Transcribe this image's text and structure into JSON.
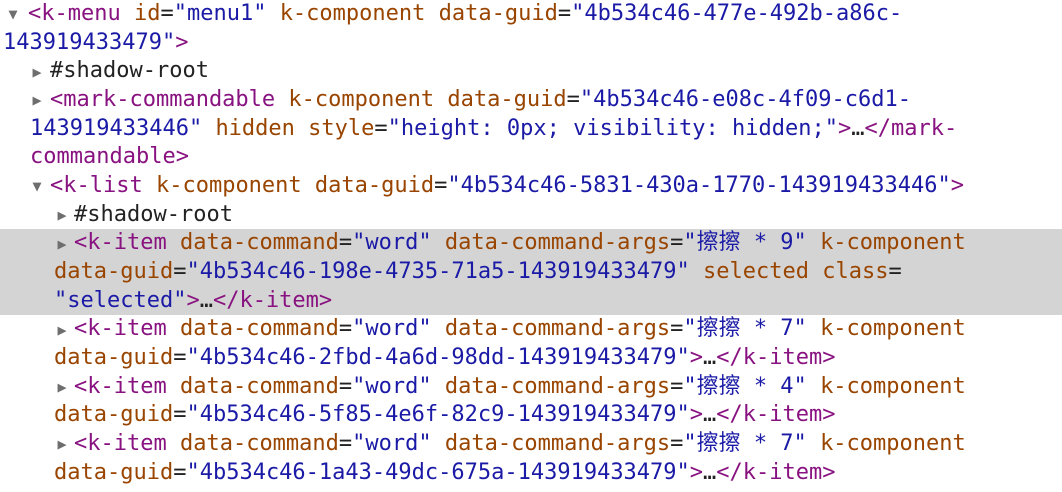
{
  "dom_tree": {
    "nodes": [
      {
        "state": "expanded",
        "lines": [
          [
            [
              "tag",
              "<k-menu"
            ],
            [
              "pl",
              " "
            ],
            [
              "an",
              "id"
            ],
            [
              "pl",
              "="
            ],
            [
              "av",
              "\"menu1\""
            ],
            [
              "pl",
              " "
            ],
            [
              "an",
              "k-component"
            ],
            [
              "pl",
              " "
            ],
            [
              "an",
              "data-guid"
            ],
            [
              "pl",
              "="
            ],
            [
              "av",
              "\"4b534c46-477e-492b-a86c-"
            ]
          ],
          [
            [
              "av",
              "143919433479\""
            ],
            [
              "tag",
              ">"
            ]
          ]
        ]
      },
      {
        "state": "collapsed",
        "lines": [
          [
            [
              "pl",
              "#shadow-root"
            ]
          ]
        ]
      },
      {
        "state": "collapsed",
        "lines": [
          [
            [
              "tag",
              "<mark-commandable"
            ],
            [
              "pl",
              " "
            ],
            [
              "an",
              "k-component"
            ],
            [
              "pl",
              " "
            ],
            [
              "an",
              "data-guid"
            ],
            [
              "pl",
              "="
            ],
            [
              "av",
              "\"4b534c46-e08c-4f09-c6d1-"
            ]
          ],
          [
            [
              "av",
              "143919433446\""
            ],
            [
              "pl",
              " "
            ],
            [
              "an",
              "hidden"
            ],
            [
              "pl",
              " "
            ],
            [
              "an",
              "style"
            ],
            [
              "pl",
              "="
            ],
            [
              "av",
              "\"height: 0px; visibility: hidden;\""
            ],
            [
              "tag",
              ">"
            ],
            [
              "pl",
              "…"
            ],
            [
              "tag",
              "</mark-"
            ]
          ],
          [
            [
              "tag",
              "commandable>"
            ]
          ]
        ]
      },
      {
        "state": "expanded",
        "lines": [
          [
            [
              "tag",
              "<k-list"
            ],
            [
              "pl",
              " "
            ],
            [
              "an",
              "k-component"
            ],
            [
              "pl",
              " "
            ],
            [
              "an",
              "data-guid"
            ],
            [
              "pl",
              "="
            ],
            [
              "av",
              "\"4b534c46-5831-430a-1770-143919433446\""
            ],
            [
              "tag",
              ">"
            ]
          ]
        ]
      },
      {
        "state": "collapsed",
        "lines": [
          [
            [
              "pl",
              "#shadow-root"
            ]
          ]
        ]
      },
      {
        "state": "collapsed",
        "selected": true,
        "lines": [
          [
            [
              "tag",
              "<k-item"
            ],
            [
              "pl",
              " "
            ],
            [
              "an",
              "data-command"
            ],
            [
              "pl",
              "="
            ],
            [
              "av",
              "\"word\""
            ],
            [
              "pl",
              " "
            ],
            [
              "an",
              "data-command-args"
            ],
            [
              "pl",
              "="
            ],
            [
              "av",
              "\"擦擦 * 9\""
            ],
            [
              "pl",
              " "
            ],
            [
              "an",
              "k-component"
            ]
          ],
          [
            [
              "an",
              "data-guid"
            ],
            [
              "pl",
              "="
            ],
            [
              "av",
              "\"4b534c46-198e-4735-71a5-143919433479\""
            ],
            [
              "pl",
              " "
            ],
            [
              "an",
              "selected"
            ],
            [
              "pl",
              " "
            ],
            [
              "an",
              "class"
            ],
            [
              "pl",
              "="
            ]
          ],
          [
            [
              "av",
              "\"selected\""
            ],
            [
              "tag",
              ">"
            ],
            [
              "pl",
              "…"
            ],
            [
              "tag",
              "</k-item>"
            ]
          ]
        ]
      },
      {
        "state": "collapsed",
        "lines": [
          [
            [
              "tag",
              "<k-item"
            ],
            [
              "pl",
              " "
            ],
            [
              "an",
              "data-command"
            ],
            [
              "pl",
              "="
            ],
            [
              "av",
              "\"word\""
            ],
            [
              "pl",
              " "
            ],
            [
              "an",
              "data-command-args"
            ],
            [
              "pl",
              "="
            ],
            [
              "av",
              "\"擦擦 * 7\""
            ],
            [
              "pl",
              " "
            ],
            [
              "an",
              "k-component"
            ]
          ],
          [
            [
              "an",
              "data-guid"
            ],
            [
              "pl",
              "="
            ],
            [
              "av",
              "\"4b534c46-2fbd-4a6d-98dd-143919433479\""
            ],
            [
              "tag",
              ">"
            ],
            [
              "pl",
              "…"
            ],
            [
              "tag",
              "</k-item>"
            ]
          ]
        ]
      },
      {
        "state": "collapsed",
        "lines": [
          [
            [
              "tag",
              "<k-item"
            ],
            [
              "pl",
              " "
            ],
            [
              "an",
              "data-command"
            ],
            [
              "pl",
              "="
            ],
            [
              "av",
              "\"word\""
            ],
            [
              "pl",
              " "
            ],
            [
              "an",
              "data-command-args"
            ],
            [
              "pl",
              "="
            ],
            [
              "av",
              "\"擦擦 * 4\""
            ],
            [
              "pl",
              " "
            ],
            [
              "an",
              "k-component"
            ]
          ],
          [
            [
              "an",
              "data-guid"
            ],
            [
              "pl",
              "="
            ],
            [
              "av",
              "\"4b534c46-5f85-4e6f-82c9-143919433479\""
            ],
            [
              "tag",
              ">"
            ],
            [
              "pl",
              "…"
            ],
            [
              "tag",
              "</k-item>"
            ]
          ]
        ]
      },
      {
        "state": "collapsed",
        "lines": [
          [
            [
              "tag",
              "<k-item"
            ],
            [
              "pl",
              " "
            ],
            [
              "an",
              "data-command"
            ],
            [
              "pl",
              "="
            ],
            [
              "av",
              "\"word\""
            ],
            [
              "pl",
              " "
            ],
            [
              "an",
              "data-command-args"
            ],
            [
              "pl",
              "="
            ],
            [
              "av",
              "\"擦擦 * 7\""
            ],
            [
              "pl",
              " "
            ],
            [
              "an",
              "k-component"
            ]
          ],
          [
            [
              "an",
              "data-guid"
            ],
            [
              "pl",
              "="
            ],
            [
              "av",
              "\"4b534c46-1a43-49dc-675a-143919433479\""
            ],
            [
              "tag",
              ">"
            ],
            [
              "pl",
              "…"
            ],
            [
              "tag",
              "</k-item>"
            ]
          ]
        ]
      }
    ]
  }
}
